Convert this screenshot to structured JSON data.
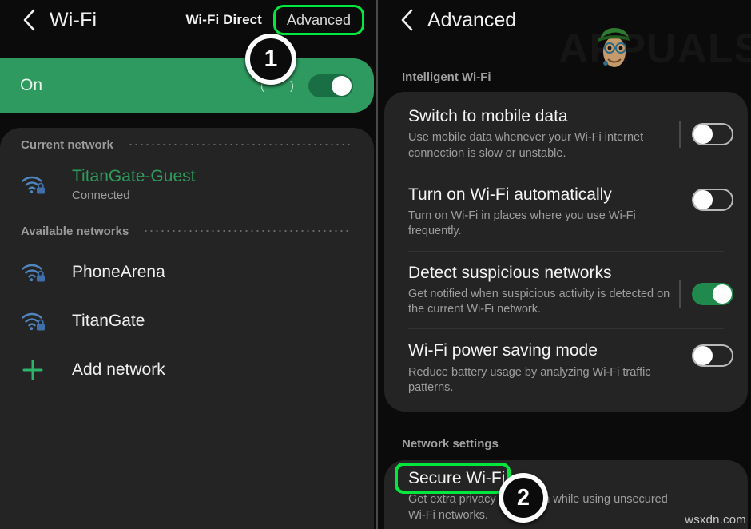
{
  "left": {
    "header": {
      "back_icon": "back-chevron-icon",
      "title": "Wi-Fi",
      "wifi_direct": "Wi-Fi Direct",
      "advanced": "Advanced"
    },
    "banner": {
      "state_label": "On",
      "paren": "( )",
      "toggle_state": "on"
    },
    "sections": [
      {
        "label": "Current network",
        "rows": [
          {
            "icon": "wifi-lock-icon",
            "name": "TitanGate-Guest",
            "sub": "Connected",
            "highlight": true
          }
        ]
      },
      {
        "label": "Available networks",
        "rows": [
          {
            "icon": "wifi-lock-icon",
            "name": "PhoneArena",
            "sub": "",
            "highlight": false
          },
          {
            "icon": "wifi-lock-icon",
            "name": "TitanGate",
            "sub": "",
            "highlight": false
          },
          {
            "icon": "plus-icon",
            "name": "Add network",
            "sub": "",
            "highlight": false
          }
        ]
      }
    ]
  },
  "right": {
    "header": {
      "back_icon": "back-chevron-icon",
      "title": "Advanced"
    },
    "watermark": "APPUALS",
    "sections": [
      {
        "label": "Intelligent Wi-Fi",
        "settings": [
          {
            "title": "Switch to mobile data",
            "desc": "Use mobile data whenever your Wi-Fi internet connection is slow or unstable.",
            "toggle": "off"
          },
          {
            "title": "Turn on Wi-Fi automatically",
            "desc": "Turn on Wi-Fi in places where you use Wi-Fi frequently.",
            "toggle": "off"
          },
          {
            "title": "Detect suspicious networks",
            "desc": "Get notified when suspicious activity is detected on the current Wi-Fi network.",
            "toggle": "on"
          },
          {
            "title": "Wi-Fi power saving mode",
            "desc": "Reduce battery usage by analyzing Wi-Fi traffic patterns.",
            "toggle": "off"
          }
        ]
      },
      {
        "label": "Network settings",
        "settings": [
          {
            "title": "Secure Wi-Fi",
            "desc": "Get extra privacy protection while using unsecured Wi-Fi networks.",
            "toggle": "none"
          }
        ]
      }
    ]
  },
  "annotations": {
    "step_1": "1",
    "step_2": "2"
  },
  "credit": "wsxdn.com",
  "colors": {
    "accent_green": "#2f9a60",
    "highlight_green": "#00e83c",
    "card_bg": "#242424",
    "page_bg": "#0b0b0b",
    "wifi_icon_blue": "#4a7fb5",
    "toggle_on": "#1f8a4c"
  }
}
